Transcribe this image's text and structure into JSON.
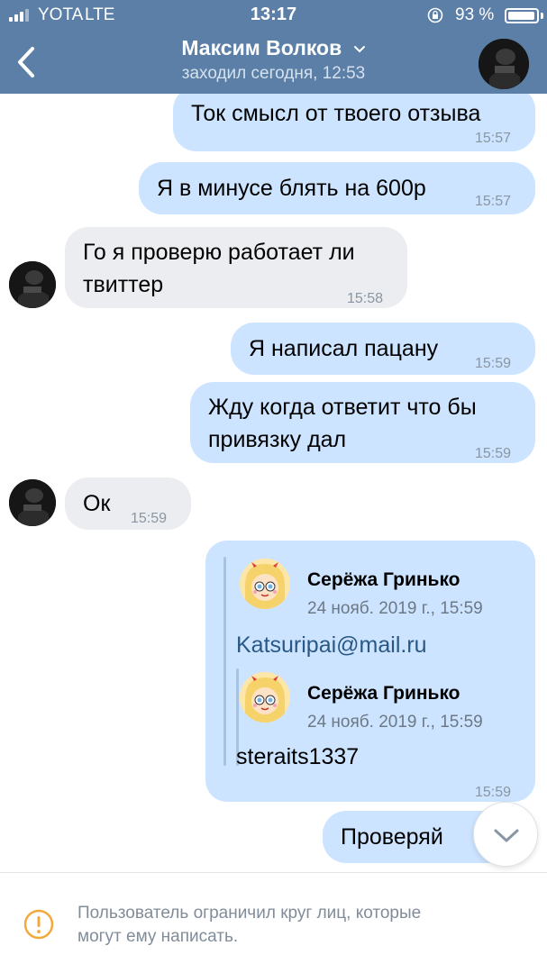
{
  "status_bar": {
    "carrier": "YOTA",
    "network": "LTE",
    "time": "13:17",
    "battery": "93 %"
  },
  "header": {
    "contact_name": "Максим Волков",
    "last_seen": "заходил сегодня, 12:53"
  },
  "messages": [
    {
      "direction": "out",
      "text": "Ток смысл от твоего отзыва",
      "time": "15:57"
    },
    {
      "direction": "out",
      "text": "Я в минусе блять на 600р",
      "time": "15:57"
    },
    {
      "direction": "in",
      "line1": "Го я проверю работает ли",
      "line2": "твиттер",
      "time": "15:58"
    },
    {
      "direction": "out",
      "text": "Я написал пацану",
      "time": "15:59"
    },
    {
      "direction": "out",
      "line1": "Жду когда ответит что бы",
      "line2": "привязку дал",
      "time": "15:59"
    },
    {
      "direction": "in",
      "text": "Ок",
      "time": "15:59"
    },
    {
      "direction": "out",
      "time": "15:59",
      "forwarded": [
        {
          "author": "Серёжа Гринько",
          "date": "24 нояб. 2019 г., 15:59",
          "text": "Katsuripai@mail.ru"
        },
        {
          "author": "Серёжа Гринько",
          "date": "24 нояб. 2019 г., 15:59",
          "text": "steraits1337"
        }
      ]
    },
    {
      "direction": "out",
      "text": "Проверяй"
    }
  ],
  "footer": {
    "notice_line1": "Пользователь ограничил круг лиц, которые",
    "notice_line2": "могут ему написать."
  },
  "colors": {
    "header_bg": "#5b7fa6",
    "outgoing_bubble": "#cce4ff",
    "incoming_bubble": "#ebedf0",
    "warning": "#f2a93b"
  },
  "icons": [
    "signal-icon",
    "lock-rotation-icon",
    "battery-icon",
    "back-arrow-icon",
    "chevron-down-icon",
    "warning-icon"
  ]
}
